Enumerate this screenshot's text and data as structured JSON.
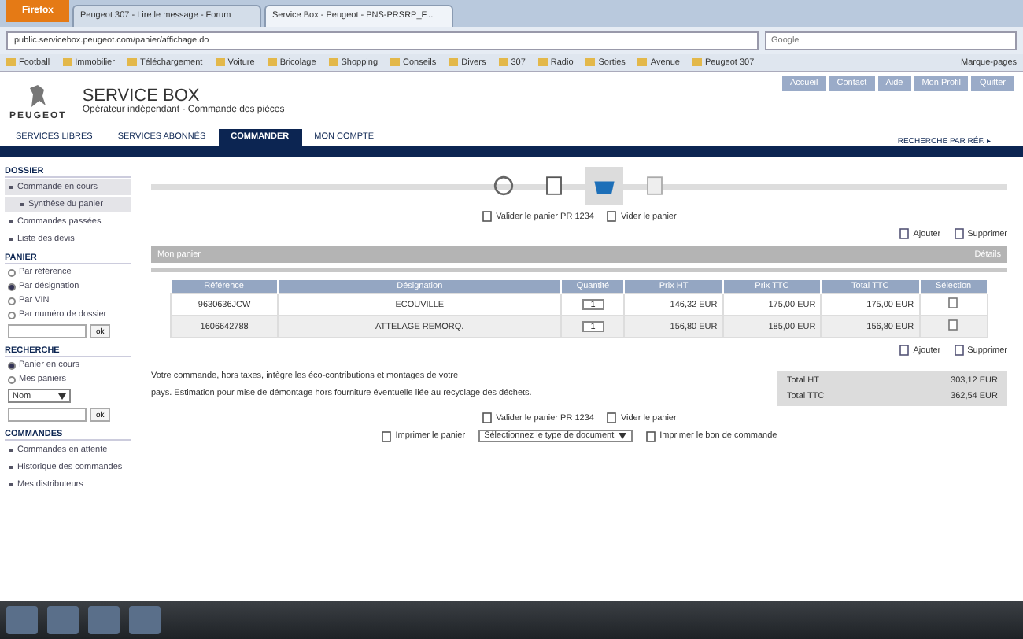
{
  "browser": {
    "menu_button": "Firefox",
    "tabs": [
      {
        "label": "Peugeot 307 - Lire le message - Forum",
        "selected": false
      },
      {
        "label": "Service Box - Peugeot - PNS-PRSRP_F...",
        "selected": true
      }
    ],
    "url": "public.servicebox.peugeot.com/panier/affichage.do",
    "search_placeholder": "Google",
    "bookmarks": [
      "Football",
      "Immobilier",
      "Téléchargement",
      "Voiture",
      "Bricolage",
      "Shopping",
      "Conseils",
      "Divers",
      "307",
      "Radio",
      "Sorties",
      "Avenue",
      "Peugeot 307"
    ],
    "bookmarks_menu": "Marque-pages"
  },
  "header": {
    "brand": "PEUGEOT",
    "title": "SERVICE BOX",
    "subtitle": "Opérateur indépendant - Commande des pièces",
    "top_links": [
      "Accueil",
      "Contact",
      "Aide",
      "Mon Profil",
      "Quitter"
    ],
    "search_label": "RECHERCHE PAR RÉF. ▸"
  },
  "nav": [
    {
      "label": "SERVICES LIBRES",
      "selected": false
    },
    {
      "label": "SERVICES ABONNÉS",
      "selected": false
    },
    {
      "label": "COMMANDER",
      "selected": true
    },
    {
      "label": "MON COMPTE",
      "selected": false
    }
  ],
  "sidebar": {
    "sections": [
      {
        "title": "DOSSIER",
        "items": [
          {
            "kind": "link",
            "label": "Commande en cours",
            "selected": true,
            "children": [
              {
                "label": "Synthèse du panier",
                "selected": true
              }
            ]
          },
          {
            "kind": "link",
            "label": "Commandes passées",
            "selected": false
          },
          {
            "kind": "link",
            "label": "Liste des devis",
            "selected": false
          }
        ]
      },
      {
        "title": "PANIER",
        "items": [
          {
            "kind": "radio",
            "label": "Par référence",
            "selected": false
          },
          {
            "kind": "radio",
            "label": "Par désignation",
            "selected": true
          },
          {
            "kind": "radio",
            "label": "Par VIN",
            "selected": false
          },
          {
            "kind": "radio",
            "label": "Par numéro de dossier",
            "selected": false
          },
          {
            "kind": "search",
            "label": "ok"
          }
        ]
      },
      {
        "title": "RECHERCHE",
        "items": [
          {
            "kind": "radio",
            "label": "Panier en cours",
            "selected": true
          },
          {
            "kind": "radio",
            "label": "Mes paniers",
            "selected": false
          },
          {
            "kind": "select",
            "label": "Nom"
          },
          {
            "kind": "search",
            "label": "ok"
          }
        ]
      },
      {
        "title": "COMMANDES",
        "items": [
          {
            "kind": "link",
            "label": "Commandes en attente",
            "selected": false
          },
          {
            "kind": "link",
            "label": "Historique des commandes",
            "selected": false
          },
          {
            "kind": "link",
            "label": "Mes distributeurs",
            "selected": false
          }
        ]
      }
    ]
  },
  "steps": [
    {
      "selected": false
    },
    {
      "selected": false
    },
    {
      "selected": true
    },
    {
      "selected": false
    }
  ],
  "actions_top": [
    "Valider le panier PR 1234",
    "Vider le panier"
  ],
  "table_tools_top": [
    "Ajouter",
    "Supprimer"
  ],
  "basket": {
    "title": "Mon panier",
    "detail": "Détails"
  },
  "table": {
    "columns": [
      "Référence",
      "Désignation",
      "Quantité",
      "Prix HT",
      "Prix TTC",
      "Total TTC",
      "Sélection"
    ],
    "rows": [
      {
        "cells": [
          "9630636JCW",
          "ECOUVILLE",
          "1",
          "146,32 EUR",
          "175,00 EUR",
          "175,00 EUR"
        ]
      },
      {
        "cells": [
          "1606642788",
          "ATTELAGE REMORQ.",
          "1",
          "156,80 EUR",
          "185,00 EUR",
          "156,80 EUR"
        ]
      }
    ]
  },
  "table_tools_bottom": [
    "Ajouter",
    "Supprimer"
  ],
  "note": [
    "Votre commande, hors taxes, intègre les éco-contributions et montages de votre",
    "pays. Estimation pour mise de démontage hors fourniture éventuelle liée au recyclage des déchets."
  ],
  "totals": [
    {
      "label": "Total HT",
      "value": "303,12 EUR"
    },
    {
      "label": "Total TTC",
      "value": "362,54 EUR"
    }
  ],
  "actions_bottom": [
    "Valider le panier PR 1234",
    "Vider le panier"
  ],
  "print": {
    "left": "Imprimer le panier",
    "select": "Sélectionnez le type de document",
    "right": "Imprimer le bon de commande"
  }
}
